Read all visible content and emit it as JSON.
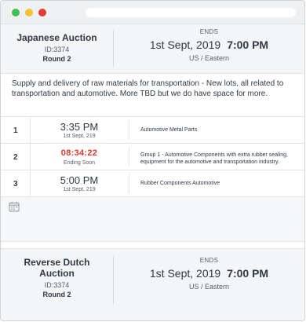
{
  "auctions": [
    {
      "title": "Japanese Auction",
      "id_text": "ID:3374",
      "round": "Round 2",
      "ends_label": "ENDS",
      "date": "1st Sept, 2019",
      "time": "7:00 PM",
      "timezone": "US / Eastern",
      "description": "Supply and delivery of raw materials for transportation - New lots, all related to transportation and automotive. More TBD but we do have space for more.",
      "lots": [
        {
          "num": "1",
          "time": "3:35 PM",
          "sub": "1st Sept, 219",
          "desc": "Automotive Metal Parts",
          "urgent": false
        },
        {
          "num": "2",
          "time": "08:34:22",
          "sub": "Ending Soon",
          "desc": "Group 1 - Automotive Components with extra rubber sealing, equipment for the automotive and transportation industry.",
          "urgent": true
        },
        {
          "num": "3",
          "time": "5:00 PM",
          "sub": "1st Sept, 219",
          "desc": "Rubber Components Automotive",
          "urgent": false
        }
      ]
    },
    {
      "title": "Reverse Dutch Auction",
      "id_text": "ID:3374",
      "round": "Round 2",
      "ends_label": "ENDS",
      "date": "1st Sept, 2019",
      "time": "7:00 PM",
      "timezone": "US / Eastern"
    }
  ],
  "icons": {
    "calendar": "calendar-icon"
  },
  "colors": {
    "urgent": "#e2372f",
    "header_bg": "#f4f5f6"
  }
}
